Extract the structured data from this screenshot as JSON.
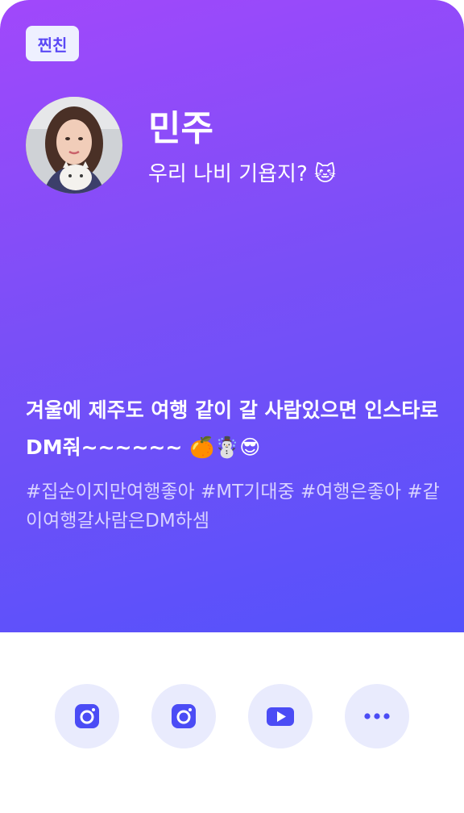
{
  "badge": {
    "label": "찐친"
  },
  "profile": {
    "name": "민주",
    "status": "우리 나비 기욥지? 🐱"
  },
  "post": {
    "text": "겨울에 제주도 여행 같이 갈 사람있으면 인스타로 DM줘~~~~~~ 🍊☃️😎",
    "hashtags": "#집순이지만여행좋아 #MT기대중 #여행은좋아 #같이여행갈사람은DM하셈"
  },
  "socials": {
    "items": [
      {
        "icon": "instagram-icon"
      },
      {
        "icon": "instagram-icon"
      },
      {
        "icon": "youtube-icon"
      },
      {
        "icon": "more-dots-icon"
      }
    ]
  },
  "colors": {
    "gradient_top": "#a148fb",
    "gradient_bottom": "#5452fb",
    "accent": "#5a48f5",
    "icon_bg": "#e9ebfd",
    "hashtag": "#d8d2ff"
  }
}
